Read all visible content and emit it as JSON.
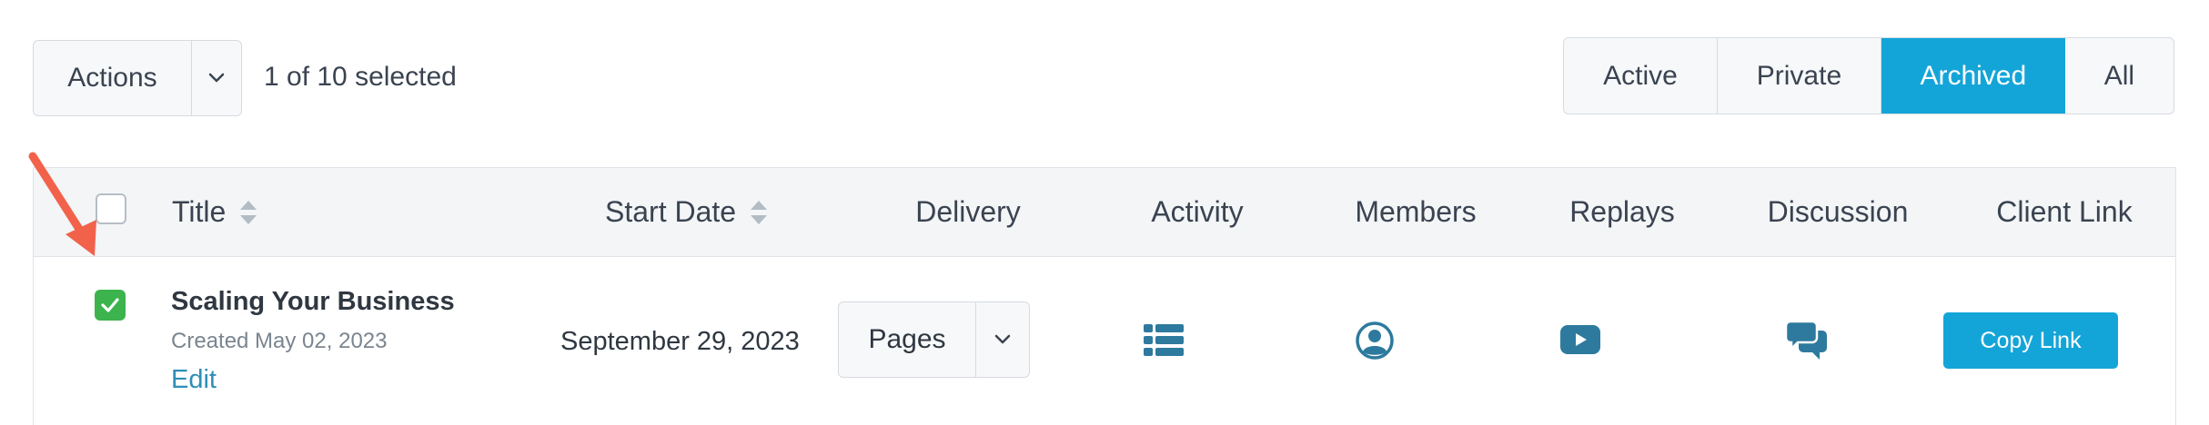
{
  "toolbar": {
    "actions_label": "Actions",
    "selected_text": "1 of 10 selected"
  },
  "filters": [
    {
      "label": "Active",
      "active": false
    },
    {
      "label": "Private",
      "active": false
    },
    {
      "label": "Archived",
      "active": true
    },
    {
      "label": "All",
      "active": false
    }
  ],
  "table": {
    "headers": {
      "title": "Title",
      "start_date": "Start Date",
      "delivery": "Delivery",
      "activity": "Activity",
      "members": "Members",
      "replays": "Replays",
      "discussion": "Discussion",
      "client_link": "Client Link"
    },
    "rows": [
      {
        "checked": true,
        "title": "Scaling Your Business",
        "created": "Created May 02, 2023",
        "edit_label": "Edit",
        "start_date": "September 29, 2023",
        "delivery": "Pages",
        "activity_icon": "list-icon",
        "members_icon": "user-circle-icon",
        "replays_icon": "play-icon",
        "discussion_icon": "chat-bubbles-icon",
        "copy_link_label": "Copy Link"
      }
    ]
  },
  "colors": {
    "accent": "#14a5d8",
    "icon": "#2d7a9e",
    "checked": "#3db34e",
    "annotation_arrow": "#f2624b"
  }
}
